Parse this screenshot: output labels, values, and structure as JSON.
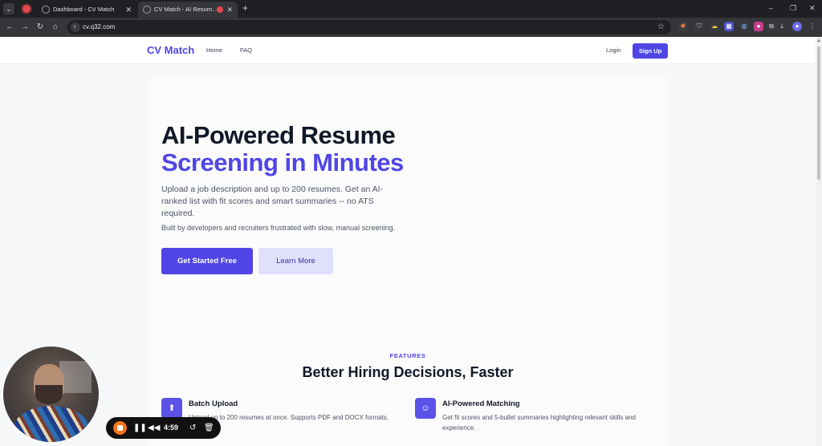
{
  "browser": {
    "tabs": [
      {
        "title": "Dashboard - CV Match",
        "active": false
      },
      {
        "title": "CV Match - AI Resume Scre",
        "active": true
      }
    ],
    "url": "cv.q32.com",
    "icons": {
      "tab_menu": "chevron-down-icon",
      "new_tab": "plus-icon",
      "back": "arrow-left-icon",
      "forward": "arrow-right-icon",
      "reload": "reload-icon",
      "home": "home-icon",
      "bookmark": "star-icon"
    },
    "window_controls": {
      "minimize": "–",
      "restore": "❐",
      "close": "✕"
    }
  },
  "site": {
    "brand": "CV Match",
    "nav": {
      "home": "Home",
      "faq": "FAQ",
      "login": "Login",
      "signup": "Sign Up"
    },
    "hero": {
      "title_line1": "AI-Powered Resume",
      "title_line2": "Screening in Minutes",
      "subtitle": "Upload a job description and up to 200 resumes. Get an AI-ranked list with fit scores and smart summaries -- no ATS required.",
      "tagline": "Built by developers and recruiters frustrated with slow, manual screening.",
      "cta_primary": "Get Started Free",
      "cta_secondary": "Learn More"
    },
    "features": {
      "eyebrow": "FEATURES",
      "title": "Better Hiring Decisions, Faster",
      "items": [
        {
          "title": "Batch Upload",
          "desc": "Upload up to 200 resumes at once. Supports PDF and DOCX formats.",
          "icon": "upload-icon"
        },
        {
          "title": "AI-Powered Matching",
          "desc": "Get fit scores and 5-bullet summaries highlighting relevant skills and experience.",
          "icon": "robot-icon"
        }
      ]
    },
    "accent_color": "#4f46e5"
  },
  "recorder": {
    "time": "4:59"
  }
}
